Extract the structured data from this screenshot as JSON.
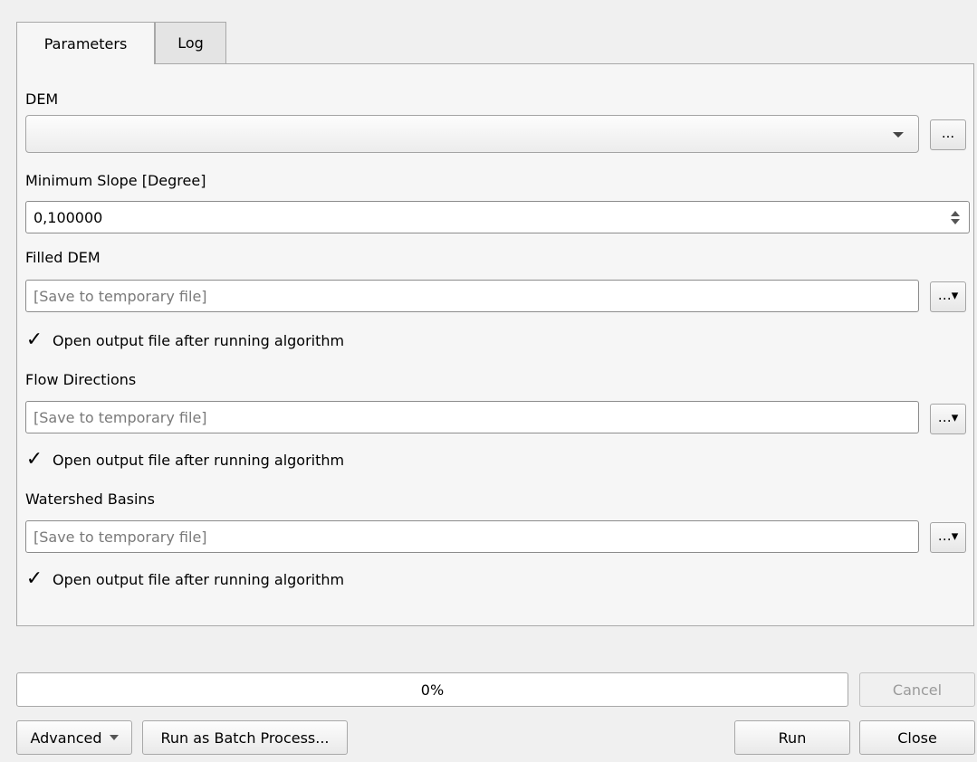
{
  "tabs": [
    {
      "label": "Parameters",
      "active": true
    },
    {
      "label": "Log",
      "active": false
    }
  ],
  "params": {
    "dem_label": "DEM",
    "dem_value": "",
    "browse_label": "...",
    "min_slope_label": "Minimum Slope [Degree]",
    "min_slope_value": "0,100000",
    "filled_dem_label": "Filled DEM",
    "flow_dir_label": "Flow Directions",
    "watershed_label": "Watershed Basins",
    "save_placeholder": "[Save to temporary file]",
    "open_output_label": "Open output file after running algorithm"
  },
  "checkboxes": {
    "filled_dem": true,
    "flow_dir": true,
    "watershed": true
  },
  "progress": {
    "value": 0,
    "text": "0%"
  },
  "buttons": {
    "cancel": "Cancel",
    "advanced": "Advanced",
    "batch": "Run as Batch Process...",
    "run": "Run",
    "close": "Close"
  }
}
